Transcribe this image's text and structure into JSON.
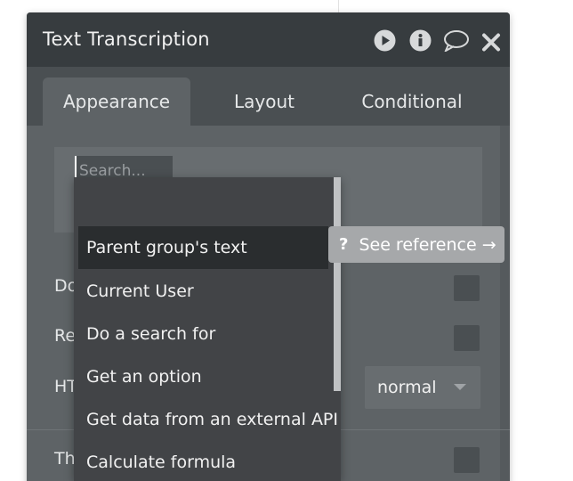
{
  "panel": {
    "title": "Text Transcription",
    "icons": [
      "play-icon",
      "info-icon",
      "comment-icon",
      "close-icon"
    ]
  },
  "tabs": [
    {
      "label": "Appearance",
      "active": true
    },
    {
      "label": "Layout",
      "active": false
    },
    {
      "label": "Conditional",
      "active": false
    }
  ],
  "search": {
    "placeholder": "Search..."
  },
  "rows": [
    {
      "label": "Do"
    },
    {
      "label": "Re"
    },
    {
      "label": "HT"
    },
    {
      "label": "Th"
    }
  ],
  "html_tag_select": {
    "value": "normal"
  },
  "dropdown": {
    "items": [
      {
        "label": "Parent group's text",
        "highlighted": true
      },
      {
        "label": "Current User"
      },
      {
        "label": "Do a search for"
      },
      {
        "label": "Get an option"
      },
      {
        "label": "Get data from an external API"
      },
      {
        "label": "Calculate formula"
      }
    ]
  },
  "reference": {
    "label": "See reference →",
    "icon": "?"
  },
  "colors": {
    "titlebar": "#373c3f",
    "panel": "#5e6366",
    "dropdown": "#424447",
    "highlight": "#2a2d2f"
  }
}
